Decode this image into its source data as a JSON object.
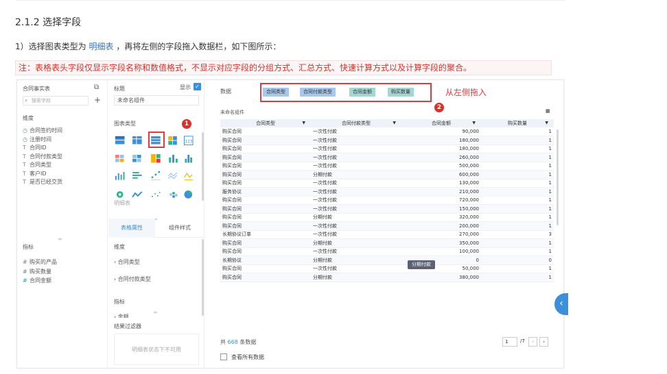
{
  "doc": {
    "heading": "2.1.2 选择字段",
    "step_prefix": "1）选择图表类型为",
    "step_highlight": "明细表",
    "step_suffix": "，再将左侧的字段拖入数据栏，如下图所示：",
    "note": "注：表格表头字段仅显示字段名称和数值格式，不显示对应字段的分组方式、汇总方式、快速计算方式以及计算字段的聚合。"
  },
  "left_panel": {
    "title": "合同事实表",
    "search_placeholder": "搜索字段",
    "dimension_label": "维度",
    "dimensions": [
      {
        "icon": "clock-icon",
        "glyph": "◷",
        "label": "合同签约时间"
      },
      {
        "icon": "clock-icon",
        "glyph": "◷",
        "label": "注册时间"
      },
      {
        "icon": "text-icon",
        "glyph": "T",
        "label": "合同ID"
      },
      {
        "icon": "text-icon",
        "glyph": "T",
        "label": "合同付款类型"
      },
      {
        "icon": "text-icon",
        "glyph": "T",
        "label": "合同类型"
      },
      {
        "icon": "text-icon",
        "glyph": "T",
        "label": "客户ID"
      },
      {
        "icon": "text-icon",
        "glyph": "T",
        "label": "是否已经交货"
      }
    ],
    "measure_label": "指标",
    "measures": [
      {
        "icon": "hash-icon",
        "glyph": "#",
        "label": "购买的产品"
      },
      {
        "icon": "hash-icon",
        "glyph": "#",
        "label": "购买数量"
      },
      {
        "icon": "hash-icon",
        "glyph": "#",
        "label": "合同金额"
      }
    ]
  },
  "mid_panel": {
    "title_label": "标题",
    "show_label": "显示",
    "component_name": "未命名组件",
    "chart_type_label": "图表类型",
    "selected_chart": "明细表",
    "tab_active": "表格属性",
    "tab_other": "组件样式",
    "dimension_label": "维度",
    "dim_items": [
      "合同类型",
      "合同付款类型"
    ],
    "measure_label": "指标",
    "measure_partial": "金额",
    "filter_label": "结果过滤器",
    "filter_disabled": "明细表状态下不可用"
  },
  "right_panel": {
    "data_label": "数据",
    "chips": [
      "合同类型",
      "合同付款类型",
      "合同金额",
      "购买数量"
    ],
    "drag_hint": "从左侧拖入",
    "component_name": "未命名组件",
    "columns": [
      "合同类型",
      "合同付款类型",
      "合同金额",
      "购买数量"
    ],
    "rows": [
      [
        "购买合同",
        "一次性付款",
        "90,000",
        "1"
      ],
      [
        "购买合同",
        "一次性付款",
        "180,000",
        "1"
      ],
      [
        "购买合同",
        "一次性付款",
        "180,000",
        "1"
      ],
      [
        "购买合同",
        "一次性付款",
        "260,000",
        "1"
      ],
      [
        "购买合同",
        "一次性付款",
        "500,000",
        "1"
      ],
      [
        "购买合同",
        "分期付款",
        "600,000",
        "1"
      ],
      [
        "购买合同",
        "一次性付款",
        "130,000",
        "1"
      ],
      [
        "服务协议",
        "一次性付款",
        "210,000",
        "1"
      ],
      [
        "购买合同",
        "一次性付款",
        "720,000",
        "1"
      ],
      [
        "购买合同",
        "一次性付款",
        "150,000",
        "1"
      ],
      [
        "购买合同",
        "分期付款",
        "320,000",
        "1"
      ],
      [
        "购买合同",
        "一次性付款",
        "200,000",
        "1"
      ],
      [
        "长期协议订单",
        "一次性付款",
        "270,000",
        "3"
      ],
      [
        "购买合同",
        "分期付款",
        "350,000",
        "1"
      ],
      [
        "购买合同",
        "一次性付款",
        "100,000",
        "1"
      ],
      [
        "长期协议",
        "分期付款",
        "0",
        "0"
      ],
      [
        "购买合同",
        "一次性付款",
        "50,000",
        "1"
      ],
      [
        "购买合同",
        "分期付款",
        "380,000",
        "1"
      ]
    ],
    "tooltip": "分期付款",
    "total_prefix": "共",
    "total_count": "668",
    "total_suffix": "条数据",
    "page_value": "1",
    "page_total": "/7",
    "view_all": "查看所有数据"
  },
  "badges": [
    "1",
    "2"
  ],
  "colors": {
    "accent": "#3c8fd9",
    "alert": "#d9322b",
    "chip_teal": "#a4d6d3",
    "chip_blue": "#a8c7ea"
  }
}
